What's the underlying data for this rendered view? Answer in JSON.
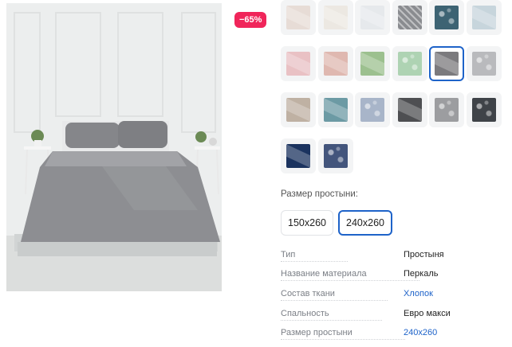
{
  "product": {
    "discount_badge": "−65%",
    "photo_alt": "bed-with-grey-linen-photo"
  },
  "swatches": [
    {
      "name": "beige-light",
      "color": "#e7dcd6",
      "style": "fold"
    },
    {
      "name": "cream",
      "color": "#ece8e2",
      "style": "fold"
    },
    {
      "name": "white",
      "color": "#e6e9ec",
      "style": "fold"
    },
    {
      "name": "grey-stripe",
      "color": "#8a8c90",
      "style": "stripes"
    },
    {
      "name": "teal-pattern",
      "color": "#3d6373",
      "style": "pattern"
    },
    {
      "name": "light-blue",
      "color": "#c7d5dc",
      "style": "fold"
    },
    {
      "name": "pink",
      "color": "#e9c1c4",
      "style": "fold"
    },
    {
      "name": "rose",
      "color": "#dfb8b0",
      "style": "fold"
    },
    {
      "name": "sage",
      "color": "#9cc08f",
      "style": "fold"
    },
    {
      "name": "mint-pattern",
      "color": "#aed3b3",
      "style": "pattern"
    },
    {
      "name": "grey",
      "color": "#7b7a7d",
      "style": "fold",
      "selected": true
    },
    {
      "name": "grey-light-pattern",
      "color": "#b9babd",
      "style": "pattern"
    },
    {
      "name": "taupe",
      "color": "#bfb1a3",
      "style": "fold"
    },
    {
      "name": "teal",
      "color": "#6c9aa4",
      "style": "fold"
    },
    {
      "name": "blue-paisley",
      "color": "#a8b5c9",
      "style": "pattern"
    },
    {
      "name": "graphite",
      "color": "#4e4f52",
      "style": "fold"
    },
    {
      "name": "grey-print",
      "color": "#9c9da0",
      "style": "pattern"
    },
    {
      "name": "dark-floral",
      "color": "#3f4348",
      "style": "pattern"
    },
    {
      "name": "navy",
      "color": "#1b335f",
      "style": "fold"
    },
    {
      "name": "navy-paisley",
      "color": "#43557c",
      "style": "pattern"
    }
  ],
  "sizes": {
    "label": "Размер простыни:",
    "options": [
      {
        "label": "150x260",
        "active": false
      },
      {
        "label": "240x260",
        "active": true
      }
    ]
  },
  "specs": [
    {
      "key": "Тип",
      "value": "Простыня",
      "link": false
    },
    {
      "key": "Название материала",
      "value": "Перкаль",
      "link": false
    },
    {
      "key": "Состав ткани",
      "value": "Хлопок",
      "link": true
    },
    {
      "key": "Спальность",
      "value": "Евро макси",
      "link": false
    },
    {
      "key": "Размер простыни",
      "value": "240x260",
      "link": true
    }
  ],
  "colors": {
    "accent": "#1e63c9",
    "badge": "#f0255a"
  }
}
